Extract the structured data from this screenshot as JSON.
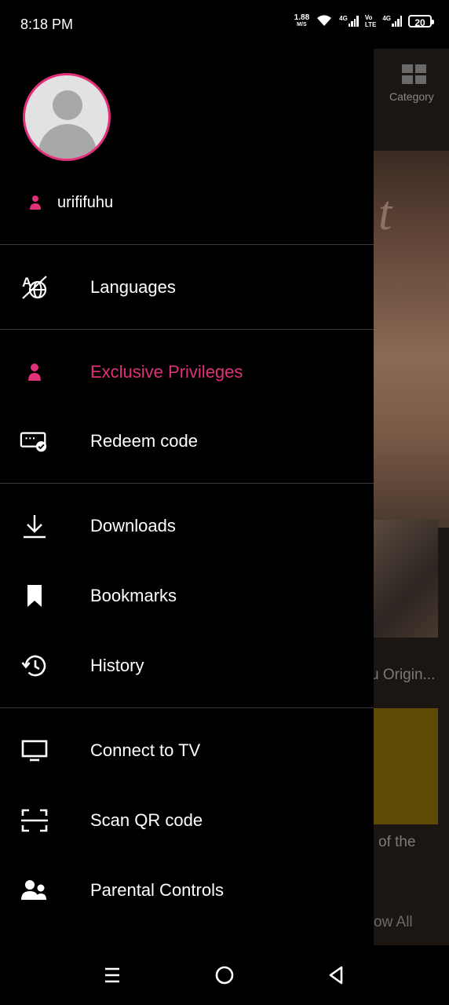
{
  "status_bar": {
    "time": "8:18 PM",
    "speed_value": "1.88",
    "speed_unit": "M/S",
    "network1": "4G",
    "volte_top": "Vo",
    "volte_bottom": "LTE",
    "network2": "4G",
    "battery": "20"
  },
  "background_app": {
    "category_label": "Category",
    "text1": "u Origin...",
    "text2": "of the",
    "text3": "ow All"
  },
  "drawer": {
    "username": "urififuhu",
    "accent_color": "#e0307a",
    "items": [
      {
        "label": "Languages",
        "icon": "translate-icon"
      },
      {
        "label": "Exclusive Privileges",
        "icon": "person-icon"
      },
      {
        "label": "Redeem code",
        "icon": "redeem-ticket-icon"
      },
      {
        "label": "Downloads",
        "icon": "download-icon"
      },
      {
        "label": "Bookmarks",
        "icon": "bookmark-icon"
      },
      {
        "label": "History",
        "icon": "history-icon"
      },
      {
        "label": "Connect to TV",
        "icon": "tv-icon"
      },
      {
        "label": "Scan QR code",
        "icon": "scan-icon"
      },
      {
        "label": "Parental Controls",
        "icon": "parental-controls-icon"
      }
    ]
  },
  "nav_bar": {
    "buttons": [
      "menu-icon",
      "home-circle-icon",
      "back-triangle-icon"
    ]
  }
}
